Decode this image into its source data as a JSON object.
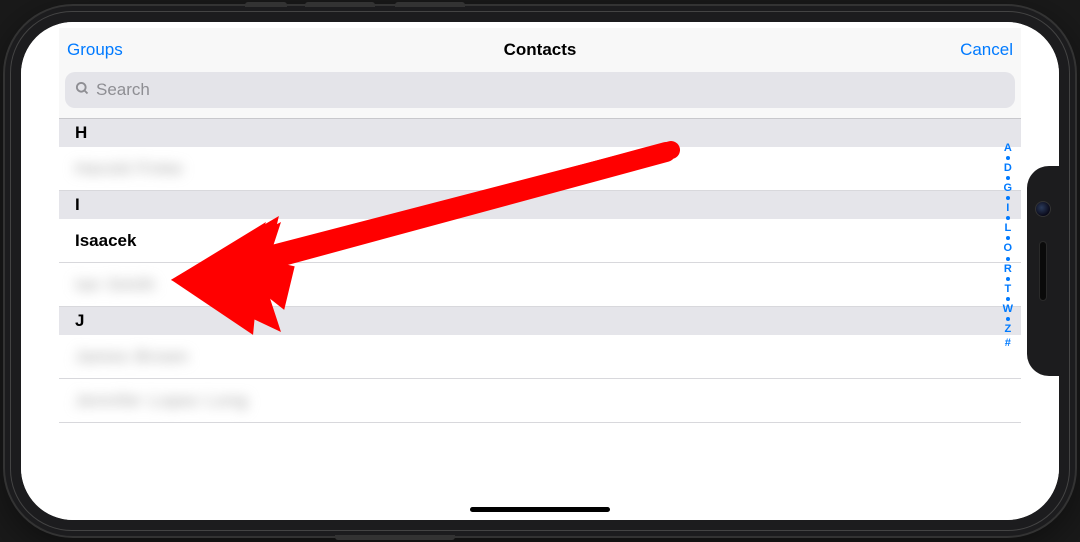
{
  "nav": {
    "left": "Groups",
    "title": "Contacts",
    "right": "Cancel"
  },
  "search": {
    "placeholder": "Search"
  },
  "sections": [
    {
      "letter": "H",
      "rows": [
        {
          "label": "Harold Finke",
          "blurred": true
        }
      ]
    },
    {
      "letter": "I",
      "rows": [
        {
          "label": "Isaacek",
          "blurred": false,
          "bold": true
        },
        {
          "label": "Ian Smith",
          "blurred": true
        }
      ]
    },
    {
      "letter": "J",
      "rows": [
        {
          "label": "James Brown",
          "blurred": true
        },
        {
          "label": "Jennifer Lopez Long",
          "blurred": true
        }
      ]
    }
  ],
  "index": [
    "A",
    "•",
    "D",
    "•",
    "G",
    "•",
    "I",
    "•",
    "L",
    "•",
    "O",
    "•",
    "R",
    "•",
    "T",
    "•",
    "W",
    "•",
    "Z",
    "#"
  ],
  "annotation": {
    "color": "#ff0000"
  }
}
